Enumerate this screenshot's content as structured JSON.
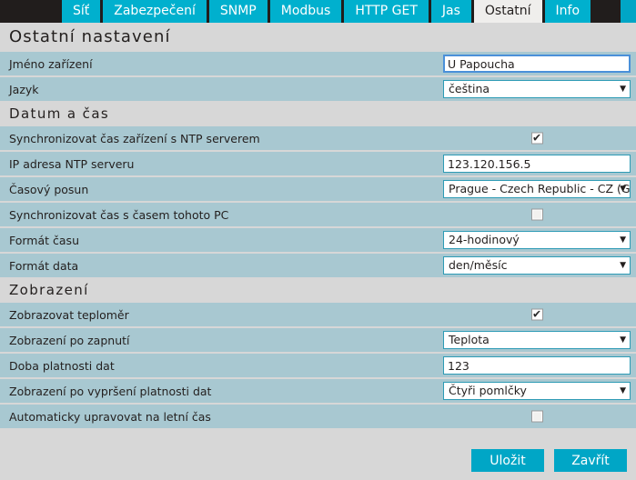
{
  "nav": {
    "tabs": [
      {
        "label": "Síť",
        "active": false
      },
      {
        "label": "Zabezpečení",
        "active": false
      },
      {
        "label": "SNMP",
        "active": false
      },
      {
        "label": "Modbus",
        "active": false
      },
      {
        "label": "HTTP GET",
        "active": false
      },
      {
        "label": "Jas",
        "active": false
      },
      {
        "label": "Ostatní",
        "active": true
      },
      {
        "label": "Info",
        "active": false
      }
    ]
  },
  "page": {
    "title": "Ostatní nastavení"
  },
  "general": {
    "device_name": {
      "label": "Jméno zařízení",
      "value": "U Papoucha"
    },
    "language": {
      "label": "Jazyk",
      "value": "čeština"
    }
  },
  "datetime": {
    "heading": "Datum a čas",
    "ntp_sync": {
      "label": "Synchronizovat čas zařízení s NTP serverem",
      "checked": true
    },
    "ntp_address": {
      "label": "IP adresa NTP serveru",
      "value": "123.120.156.5"
    },
    "timezone": {
      "label": "Časový posun",
      "value": "Prague - Czech Republic - CZ (GMT +"
    },
    "pc_sync": {
      "label": "Synchronizovat čas s časem tohoto PC",
      "checked": false
    },
    "time_format": {
      "label": "Formát času",
      "value": "24-hodinový"
    },
    "date_format": {
      "label": "Formát data",
      "value": "den/měsíc"
    }
  },
  "display": {
    "heading": "Zobrazení",
    "show_thermometer": {
      "label": "Zobrazovat teploměr",
      "checked": true
    },
    "startup_view": {
      "label": "Zobrazení po zapnutí",
      "value": "Teplota"
    },
    "data_validity": {
      "label": "Doba platnosti dat",
      "value": "123"
    },
    "expired_view": {
      "label": "Zobrazení po vypršení platnosti dat",
      "value": "Čtyři pomlčky"
    },
    "dst_auto": {
      "label": "Automaticky upravovat na letní čas",
      "checked": false
    }
  },
  "footer": {
    "save_label": "Uložit",
    "close_label": "Zavřít"
  },
  "icons": {
    "chevron_down": "▼",
    "check_mark": "✔"
  }
}
